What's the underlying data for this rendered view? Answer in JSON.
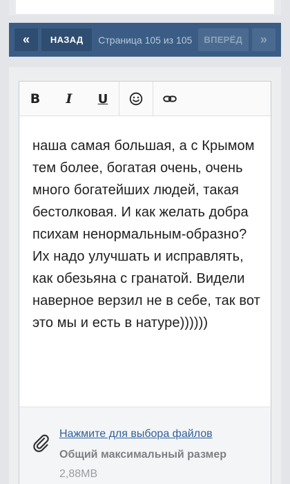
{
  "pagination": {
    "first_icon": "«",
    "prev_label": "НАЗАД",
    "status": "Страница 105 из 105",
    "next_label": "ВПЕРЁД",
    "last_icon": "»"
  },
  "editor": {
    "toolbar": {
      "bold": "B",
      "italic": "I",
      "underline": "U",
      "emoji_icon": "smiley-icon",
      "link_icon": "link-icon"
    },
    "text": "наша самая большая, а с Крымом тем более, богатая очень, очень много богатейших людей, такая бестолковая. И как желать добра психам ненормальным-образно? Их надо улучшать и исправлять, как обезьяна с гранатой. Видели наверное верзил не в себе, так вот это мы и есть в натуре))))))"
  },
  "attachments": {
    "icon": "paperclip-icon",
    "choose_files_label": "Нажмите для выбора файлов",
    "max_size_label": "Общий максимальный размер",
    "max_size_value": "2,88MB"
  },
  "colors": {
    "pager_bg": "#3b5d85",
    "link": "#2f5f98"
  }
}
